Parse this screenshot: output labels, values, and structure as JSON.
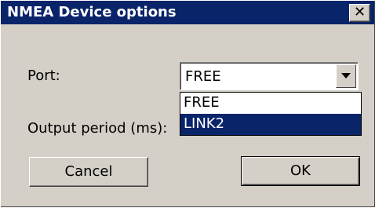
{
  "window": {
    "title": "NMEA Device options",
    "close_glyph": "✕"
  },
  "form": {
    "port_label": "Port:",
    "port_value": "FREE",
    "output_period_label": "Output period (ms):"
  },
  "dropdown": {
    "options": [
      "FREE",
      "LINK2"
    ],
    "highlighted": "LINK2"
  },
  "buttons": {
    "cancel_label": "Cancel",
    "ok_label": "OK"
  },
  "colors": {
    "titlebar": "#0a246a",
    "dialog_face": "#d4d0c8",
    "selection": "#0a246a"
  },
  "icons": {
    "combo_arrow": "chevron-down-icon",
    "close": "close-icon"
  }
}
